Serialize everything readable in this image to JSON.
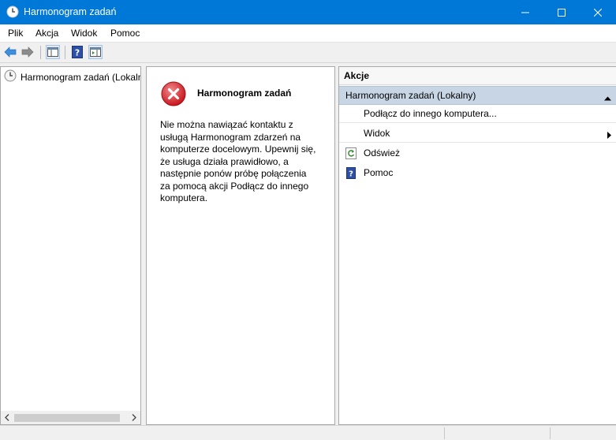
{
  "window": {
    "title": "Harmonogram zadań",
    "accent_color": "#0078d7"
  },
  "menu": [
    "Plik",
    "Akcja",
    "Widok",
    "Pomoc"
  ],
  "toolbar": {
    "icons": [
      "back-arrow-icon",
      "forward-arrow-icon",
      "show-hide-console-tree-icon",
      "help-icon",
      "show-hide-action-pane-icon"
    ]
  },
  "tree": {
    "root_label": "Harmonogram zadań (Lokaln"
  },
  "center": {
    "title": "Harmonogram zadań",
    "message": "Nie można nawiązać kontaktu z usługą Harmonogram zdarzeń na komputerze docelowym. Upewnij się, że usługa działa prawidłowo, a następnie ponów próbę połączenia za pomocą akcji Podłącz do innego komputera."
  },
  "actions": {
    "header": "Akcje",
    "section_title": "Harmonogram zadań (Lokalny)",
    "items": [
      {
        "label": "Podłącz do innego komputera...",
        "icon": "none"
      },
      {
        "label": "Widok",
        "icon": "none",
        "has_submenu": true
      },
      {
        "label": "Odśwież",
        "icon": "refresh-icon"
      },
      {
        "label": "Pomoc",
        "icon": "help-icon"
      }
    ]
  }
}
